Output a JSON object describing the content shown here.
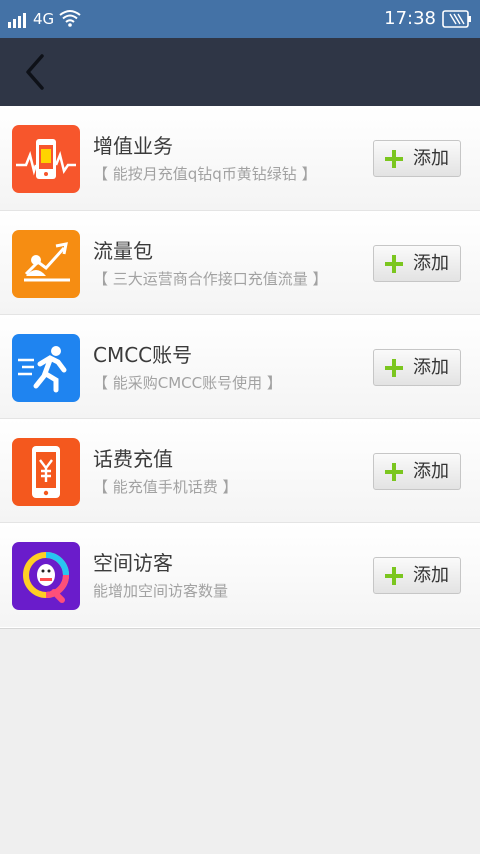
{
  "status_bar": {
    "network": "4G",
    "time": "17:38"
  },
  "nav": {
    "back_icon": "chevron-left-icon"
  },
  "items": [
    {
      "title": "增值业务",
      "description": "【 能按月充值q钻q币黄钻绿钻 】",
      "icon": "phone-recharge-icon",
      "icon_color": "#f7562c",
      "button_label": "添加"
    },
    {
      "title": "流量包",
      "description": "【 三大运营商合作接口充值流量 】",
      "icon": "data-growth-chart-icon",
      "icon_color": "#f68d12",
      "button_label": "添加"
    },
    {
      "title": "CMCC账号",
      "description": "【 能采购CMCC账号使用 】",
      "icon": "running-man-icon",
      "icon_color": "#1f84f0",
      "button_label": "添加"
    },
    {
      "title": "话费充值",
      "description": "【 能充值手机话费 】",
      "icon": "phone-yuan-icon",
      "icon_color": "#f4581e",
      "button_label": "添加"
    },
    {
      "title": "空间访客",
      "description": "能增加空间访客数量",
      "icon": "qq-zone-visitor-icon",
      "icon_color": "#6a1ccb",
      "button_label": "添加"
    }
  ],
  "colors": {
    "status_bar": "#4472a6",
    "nav_bar": "#2f3646",
    "plus_accent": "#7bc61f"
  }
}
